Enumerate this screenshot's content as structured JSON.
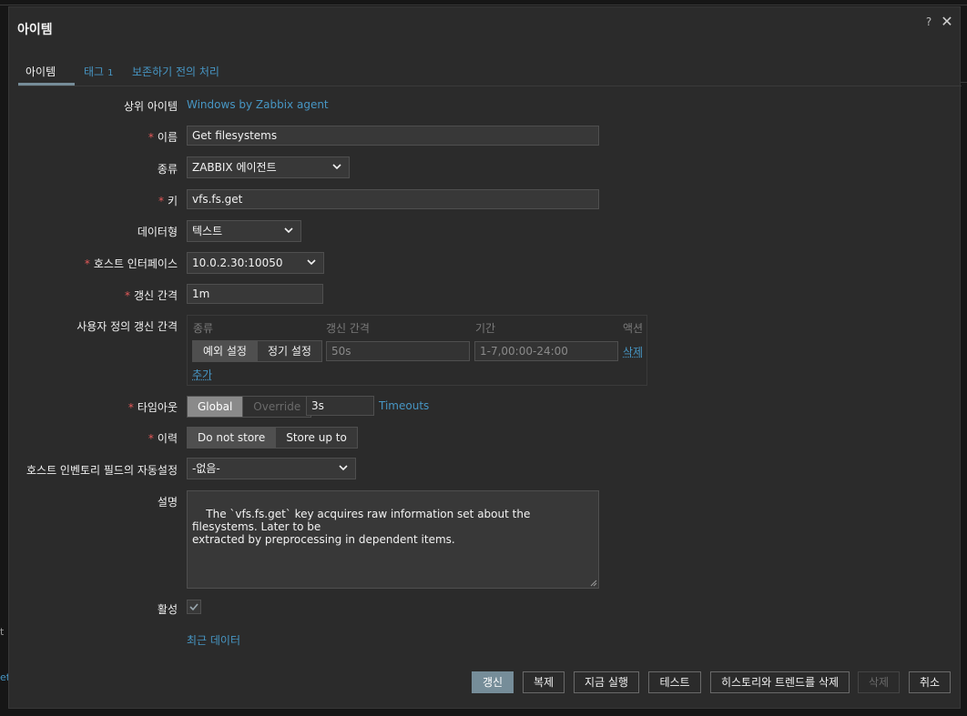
{
  "dialog": {
    "title": "아이템",
    "help_icon": "?",
    "close_icon": "✕"
  },
  "tabs": [
    {
      "label": "아이템",
      "count": ""
    },
    {
      "label": "태그",
      "count": "1"
    },
    {
      "label": "보존하기 전의 처리",
      "count": ""
    }
  ],
  "form": {
    "parent_items": {
      "label": "상위 아이템",
      "value": "Windows by Zabbix agent"
    },
    "name": {
      "label": "이름",
      "value": "Get filesystems"
    },
    "type": {
      "label": "종류",
      "value": "ZABBIX 에이전트"
    },
    "key": {
      "label": "키",
      "value": "vfs.fs.get"
    },
    "value_type": {
      "label": "데이터형",
      "value": "텍스트"
    },
    "host_interface": {
      "label": "호스트 인터페이스",
      "value": "10.0.2.30:10050"
    },
    "update_interval": {
      "label": "갱신 간격",
      "value": "1m"
    },
    "custom_intervals": {
      "label": "사용자 정의 갱신 간격",
      "headers": {
        "type": "종류",
        "interval": "갱신 간격",
        "period": "기간",
        "action": "액션"
      },
      "row": {
        "type_options": [
          "예외 설정",
          "정기 설정"
        ],
        "interval": "50s",
        "period": "1-7,00:00-24:00",
        "remove": "삭제"
      },
      "add": "추가"
    },
    "timeout": {
      "label": "타임아웃",
      "options": [
        "Global",
        "Override"
      ],
      "value": "3s",
      "link": "Timeouts"
    },
    "history": {
      "label": "이력",
      "options": [
        "Do not store",
        "Store up to"
      ]
    },
    "inventory": {
      "label": "호스트 인벤토리 필드의 자동설정",
      "value": "-없음-"
    },
    "description": {
      "label": "설명",
      "value": "The `vfs.fs.get` key acquires raw information set about the filesystems. Later to be\nextracted by preprocessing in dependent items."
    },
    "enabled": {
      "label": "활성",
      "checked": true
    },
    "latest_data": "최근 데이터"
  },
  "buttons": {
    "update": "갱신",
    "clone": "복제",
    "execute_now": "지금 실행",
    "test": "테스트",
    "clear_history": "히스토리와 트렌드를 삭제",
    "delete": "삭제",
    "cancel": "취소"
  },
  "colors": {
    "accent": "#768d99",
    "link": "#4796c4",
    "required": "#e45959",
    "background": "#2b2b2b"
  }
}
